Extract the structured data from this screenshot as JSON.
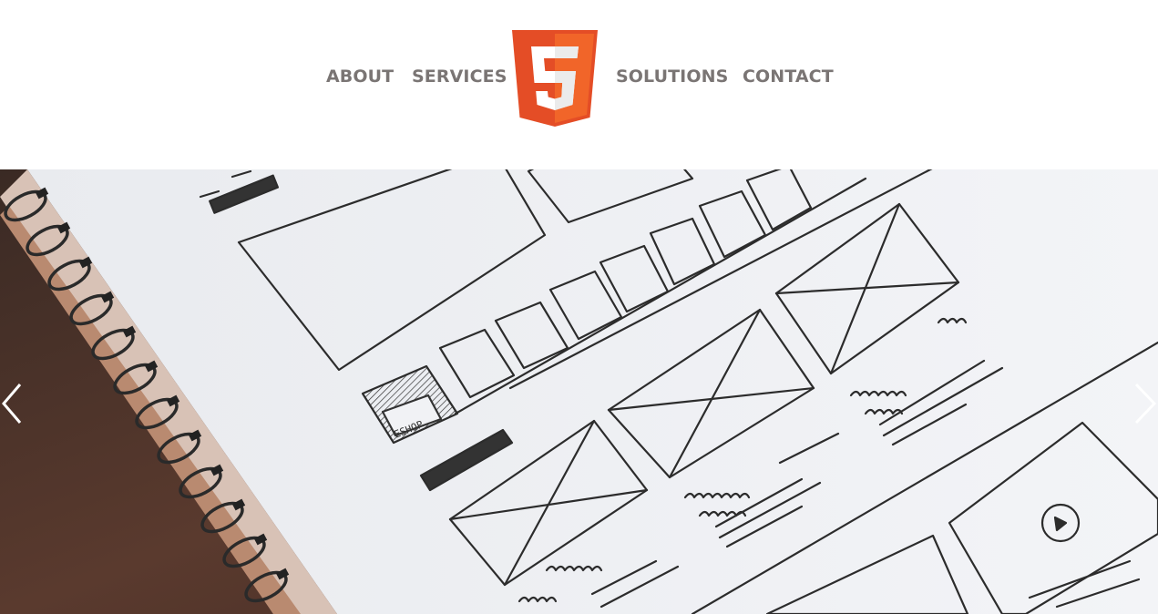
{
  "nav": {
    "items": [
      {
        "label": "ABOUT"
      },
      {
        "label": "SERVICES"
      },
      {
        "label": "SOLUTIONS"
      },
      {
        "label": "CONTACT"
      }
    ],
    "logo_icon": "html5-logo-icon"
  },
  "slider": {
    "image": "wireframe-sketch-notebook",
    "prev_icon": "chevron-left-icon",
    "next_icon": "chevron-right-icon",
    "sketch_label": "ESHOP"
  },
  "colors": {
    "nav_text": "#7a7574",
    "logo_orange": "#e44d26",
    "logo_light": "#f16529",
    "paper": "#eceef2",
    "wood": "#4a3128"
  }
}
